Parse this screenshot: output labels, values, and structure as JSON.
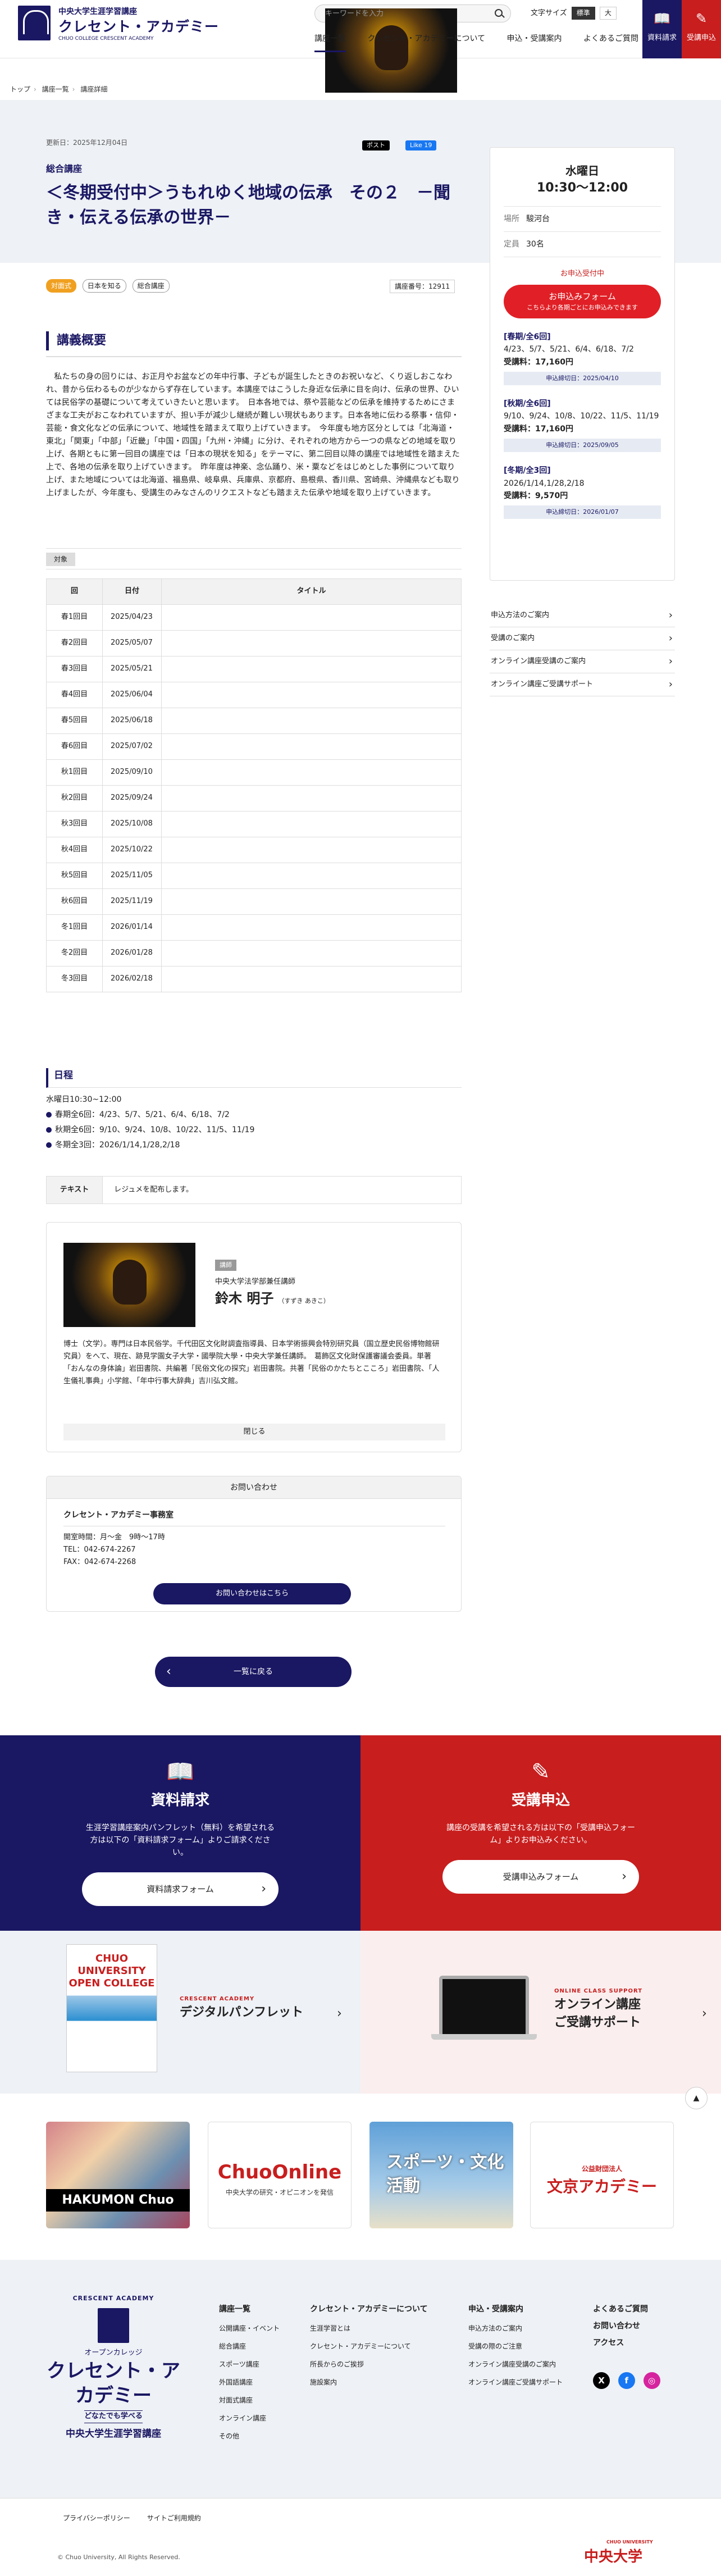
{
  "header": {
    "logo_line1": "中央大学生涯学習講座",
    "logo_line2": "クレセント・アカデミー",
    "logo_line3": "CHUO COLLEGE CRESCENT ACADEMY",
    "search_placeholder": "キーワードを入力",
    "font_size_label": "文字サイズ",
    "font_size_options": [
      "標準",
      "大"
    ],
    "nav": [
      "講座一覧",
      "クレセント・アカデミーについて",
      "申込・受講案内",
      "よくあるご質問"
    ],
    "request_label": "資料請求",
    "apply_label": "受講申込"
  },
  "breadcrumb": [
    "トップ",
    "講座一覧",
    "講座詳細"
  ],
  "course": {
    "updated": "更新日：2025年12月04日",
    "share_x": "ポスト",
    "share_fb": "Like 19",
    "category": "総合講座",
    "title": "＜冬期受付中＞うもれゆく地域の伝承　その２　－聞き・伝える伝承の世界－",
    "tags": [
      "対面式",
      "日本を知る",
      "総合講座"
    ],
    "course_no": "講座番号：12911",
    "overview_heading": "講義概要",
    "overview": "　私たちの身の回りには、お正月やお盆などの年中行事、子どもが誕生したときのお祝いなど、くり返しおこなわれ、昔から伝わるものが少なからず存在しています。本講座ではこうした身近な伝承に目を向け、伝承の世界、ひいては民俗学の基礎について考えていきたいと思います。　日本各地では、祭や芸能などの伝承を維持するためにさまざまな工夫がおこなわれていますが、担い手が減少し継続が難しい現状もあります。日本各地に伝わる祭事・信仰・芸能・食文化などの伝承について、地域性を踏まえて取り上げていきます。　今年度も地方区分としては「北海道・東北」「関東」「中部」「近畿」「中国・四国」「九州・沖縄」に分け、それぞれの地方から一つの県などの地域を取り上げ、各期ともに第一回目の講座では「日本の現状を知る」をテーマに、第二回目以降の講座では地域性を踏まえた上で、各地の伝承を取り上げていきます。　昨年度は神楽、念仏踊り、米・粟などをはじめとした事例について取り上げ、また地域については北海道、福島県、岐阜県、兵庫県、京都府、島根県、香川県、宮崎県、沖縄県なども取り上げましたが、今年度も、受講生のみなさんのリクエストなども踏まえた伝承や地域を取り上げていきます。",
    "target_label": "対象",
    "table_headers": [
      "回",
      "日付",
      "タイトル"
    ],
    "sessions": [
      [
        "春1回目",
        "2025/04/23",
        ""
      ],
      [
        "春2回目",
        "2025/05/07",
        ""
      ],
      [
        "春3回目",
        "2025/05/21",
        ""
      ],
      [
        "春4回目",
        "2025/06/04",
        ""
      ],
      [
        "春5回目",
        "2025/06/18",
        ""
      ],
      [
        "春6回目",
        "2025/07/02",
        ""
      ],
      [
        "秋1回目",
        "2025/09/10",
        ""
      ],
      [
        "秋2回目",
        "2025/09/24",
        ""
      ],
      [
        "秋3回目",
        "2025/10/08",
        ""
      ],
      [
        "秋4回目",
        "2025/10/22",
        ""
      ],
      [
        "秋5回目",
        "2025/11/05",
        ""
      ],
      [
        "秋6回目",
        "2025/11/19",
        ""
      ],
      [
        "冬1回目",
        "2026/01/14",
        ""
      ],
      [
        "冬2回目",
        "2026/01/28",
        ""
      ],
      [
        "冬3回目",
        "2026/02/18",
        ""
      ]
    ],
    "schedule_heading": "日程",
    "schedule_time": "水曜日10:30~12:00",
    "schedule_lines": [
      "春期全6回：4/23、5/7、5/21、6/4、6/18、7/2",
      "秋期全6回：9/10、9/24、10/8、10/22、11/5、11/19",
      "冬期全3回：2026/1/14,1/28,2/18"
    ],
    "text_label": "テキスト",
    "text_value": "レジュメを配布します。"
  },
  "lecturer": {
    "role": "講師",
    "org": "中央大学法学部兼任講師",
    "name": "鈴木 明子",
    "kana": "（すずき あきこ）",
    "bio": "博士（文学）。専門は日本民俗学。千代田区文化財調査指導員、日本学術振興会特別研究員（国立歴史民俗博物館研究員）をへて、現在、跡見学園女子大学・國學院大學・中央大学兼任講師。　葛飾区文化財保護審議会委員。単著「おんなの身体論」岩田書院、共編著「民俗文化の探究」岩田書院。共著「民俗のかたちとこころ」岩田書院、「人生儀礼事典」小学館、「年中行事大辞典」吉川弘文館。",
    "close": "閉じる"
  },
  "inquiry": {
    "heading": "お問い合わせ",
    "office": "クレセント・アカデミー事務室",
    "hours": "開室時間：月～金　9時～17時",
    "tel": "TEL：042-674-2267",
    "fax": "FAX：042-674-2268",
    "button": "お問い合わせはこちら"
  },
  "back_button": "一覧に戻る",
  "sidebar": {
    "day": "水曜日",
    "time": "10:30～12:00",
    "place_k": "場所",
    "place_v": "駿河台",
    "cap_k": "定員",
    "cap_v": "30名",
    "cta_note": "お申込受付中",
    "cta": "お申込みフォーム",
    "cta_sub": "こちらより各期ごとにお申込みできます",
    "terms": [
      {
        "label": "[春期/全6回]",
        "dates": "4/23、5/7、5/21、6/4、6/18、7/2",
        "fee": "受講料：17,160円",
        "deadline": "申込締切日：2025/04/10"
      },
      {
        "label": "[秋期/全6回]",
        "dates": "9/10、9/24、10/8、10/22、11/5、11/19",
        "fee": "受講料：17,160円",
        "deadline": "申込締切日：2025/09/05"
      },
      {
        "label": "[冬期/全3回]",
        "dates": "2026/1/14,1/28,2/18",
        "fee": "受講料：9,570円",
        "deadline": "申込締切日：2026/01/07"
      }
    ],
    "links": [
      "申込方法のご案内",
      "受講のご案内",
      "オンライン講座受講のご案内",
      "オンライン講座ご受講サポート"
    ]
  },
  "banners": {
    "request_title": "資料請求",
    "request_desc": "生涯学習講座案内パンフレット（無料）を希望される方は以下の「資料請求フォーム」よりご請求ください。",
    "request_btn": "資料請求フォーム",
    "apply_title": "受講申込",
    "apply_desc": "講座の受講を希望される方は以下の「受講申込フォーム」よりお申込みください。",
    "apply_btn": "受講申込みフォーム",
    "pamph_en": "CRESCENT ACADEMY",
    "pamph_jp": "デジタルパンフレット",
    "pamph_cover": "CHUO UNIVERSITY OPEN COLLEGE",
    "online_en": "ONLINE CLASS SUPPORT",
    "online_jp1": "オンライン講座",
    "online_jp2": "ご受講サポート",
    "ext1": "HAKUMON Chuo",
    "ext2a": "ChuoOnline",
    "ext2b": "中央大学の研究・オピニオンを発信",
    "ext3": "スポーツ・文化活動",
    "ext4a": "公益財団法人",
    "ext4b": "文京アカデミー"
  },
  "footer": {
    "logo_en": "CRESCENT ACADEMY",
    "logo_s": "オープンカレッジ",
    "logo_b": "クレセント・アカデミー",
    "logo_c": "どなたでも学べる",
    "logo_d": "中央大学生涯学習講座",
    "col1_h": "講座一覧",
    "col1": [
      "公開講座・イベント",
      "総合講座",
      "スポーツ講座",
      "外国語講座",
      "対面式講座",
      "オンライン講座",
      "その他"
    ],
    "col2_h": "クレセント・アカデミーについて",
    "col2": [
      "生涯学習とは",
      "クレセント・アカデミーについて",
      "所長からのご挨拶",
      "施設案内"
    ],
    "col3_h": "申込・受講案内",
    "col3": [
      "申込方法のご案内",
      "受講の際のご注意",
      "オンライン講座受講のご案内",
      "オンライン講座ご受講サポート"
    ],
    "col4": [
      "よくあるご質問",
      "お問い合わせ",
      "アクセス"
    ],
    "links": [
      "プライバシーポリシー",
      "サイトご利用規約"
    ],
    "copyright": "© Chuo University, All Rights Reserved.",
    "univ": "中央大学",
    "univ_sub": "CHUO UNIVERSITY"
  }
}
